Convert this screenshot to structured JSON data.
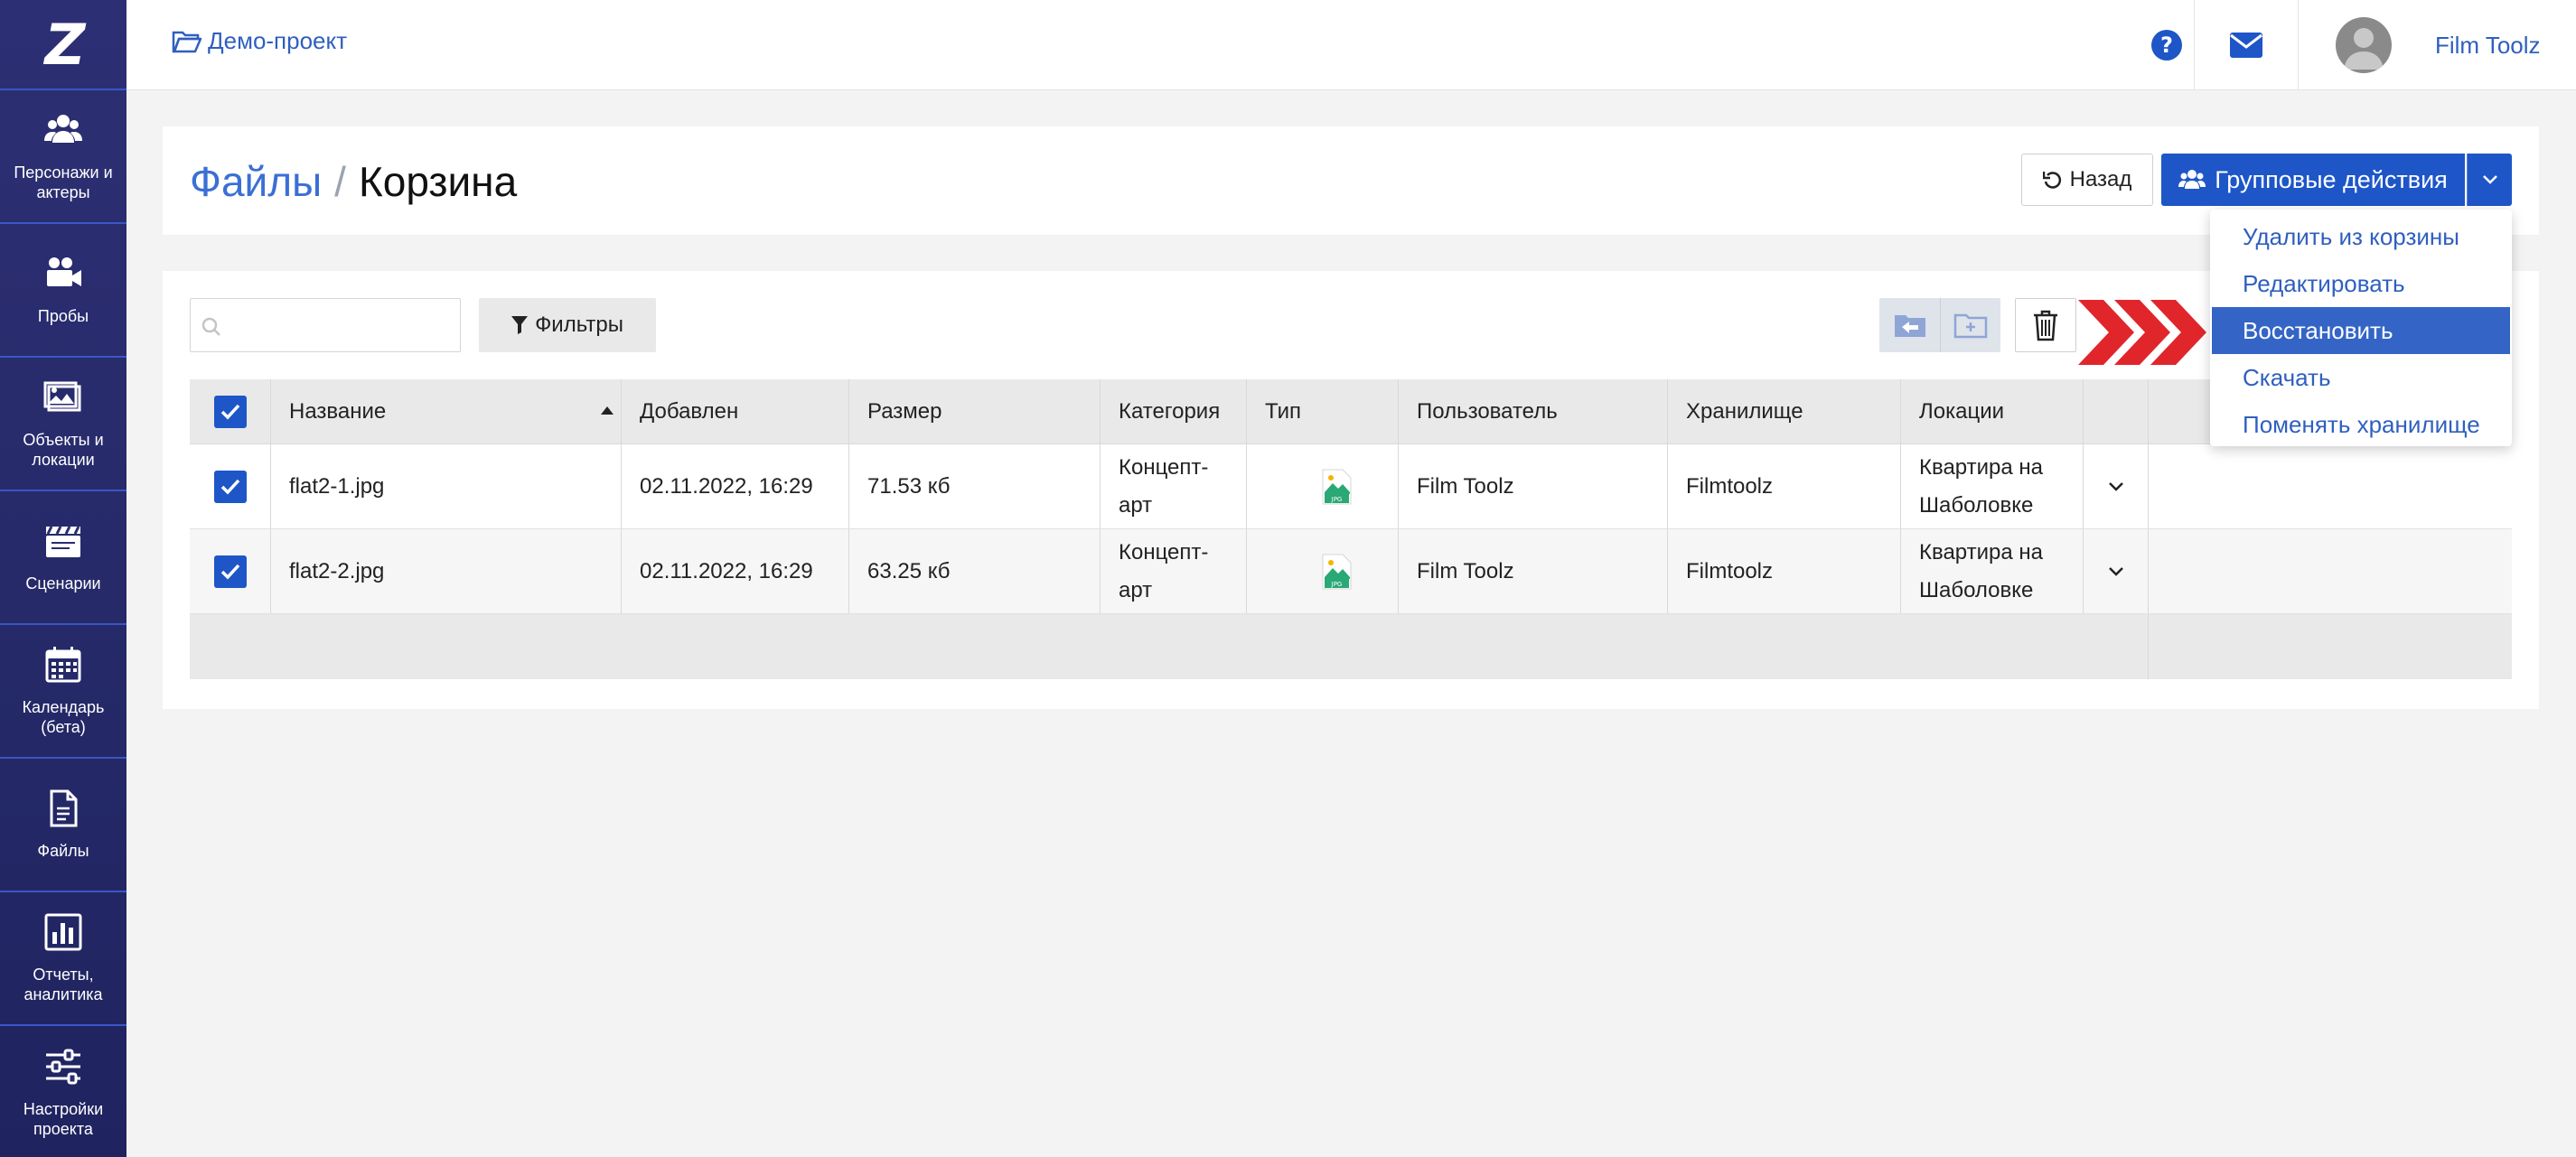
{
  "app": {
    "logo_text": "Z"
  },
  "sidebar": {
    "items": [
      {
        "label": "Персонажи и актеры",
        "icon": "users-icon"
      },
      {
        "label": "Пробы",
        "icon": "video-camera-icon"
      },
      {
        "label": "Объекты и локации",
        "icon": "image-icon"
      },
      {
        "label": "Сценарии",
        "icon": "clapperboard-icon"
      },
      {
        "label": "Календарь (бета)",
        "icon": "calendar-icon"
      },
      {
        "label": "Файлы",
        "icon": "file-icon"
      },
      {
        "label": "Отчеты, аналитика",
        "icon": "bar-chart-icon"
      },
      {
        "label": "Настройки проекта",
        "icon": "sliders-icon"
      }
    ]
  },
  "topbar": {
    "project_name": "Демо-проект",
    "user_name": "Film Toolz"
  },
  "header": {
    "breadcrumb_link": "Файлы",
    "breadcrumb_separator": "/",
    "breadcrumb_current": "Корзина",
    "back_label": "Назад",
    "group_actions_label": "Групповые действия"
  },
  "toolbar": {
    "search_placeholder": "",
    "filter_label": "Фильтры"
  },
  "table": {
    "columns": [
      "Название",
      "Добавлен",
      "Размер",
      "Категория",
      "Тип",
      "Пользователь",
      "Хранилище",
      "Локации"
    ],
    "rows": [
      {
        "name": "flat2-1.jpg",
        "added": "02.11.2022, 16:29",
        "size": "71.53 кб",
        "category": "Концепт-арт",
        "type": "JPG",
        "user": "Film Toolz",
        "storage": "Filmtoolz",
        "location": "Квартира на Шаболовке",
        "checked": true
      },
      {
        "name": "flat2-2.jpg",
        "added": "02.11.2022, 16:29",
        "size": "63.25 кб",
        "category": "Концепт-арт",
        "type": "JPG",
        "user": "Film Toolz",
        "storage": "Filmtoolz",
        "location": "Квартира на Шаболовке",
        "checked": true
      }
    ]
  },
  "dropdown": {
    "items": [
      "Удалить из корзины",
      "Редактировать",
      "Восстановить",
      "Скачать",
      "Поменять хранилище"
    ],
    "active_index": 2
  },
  "colors": {
    "sidebar_bg": "#2a2d70",
    "accent": "#1e56c8",
    "link": "#2f5fbf",
    "highlight_arrows": "#e0262b"
  }
}
